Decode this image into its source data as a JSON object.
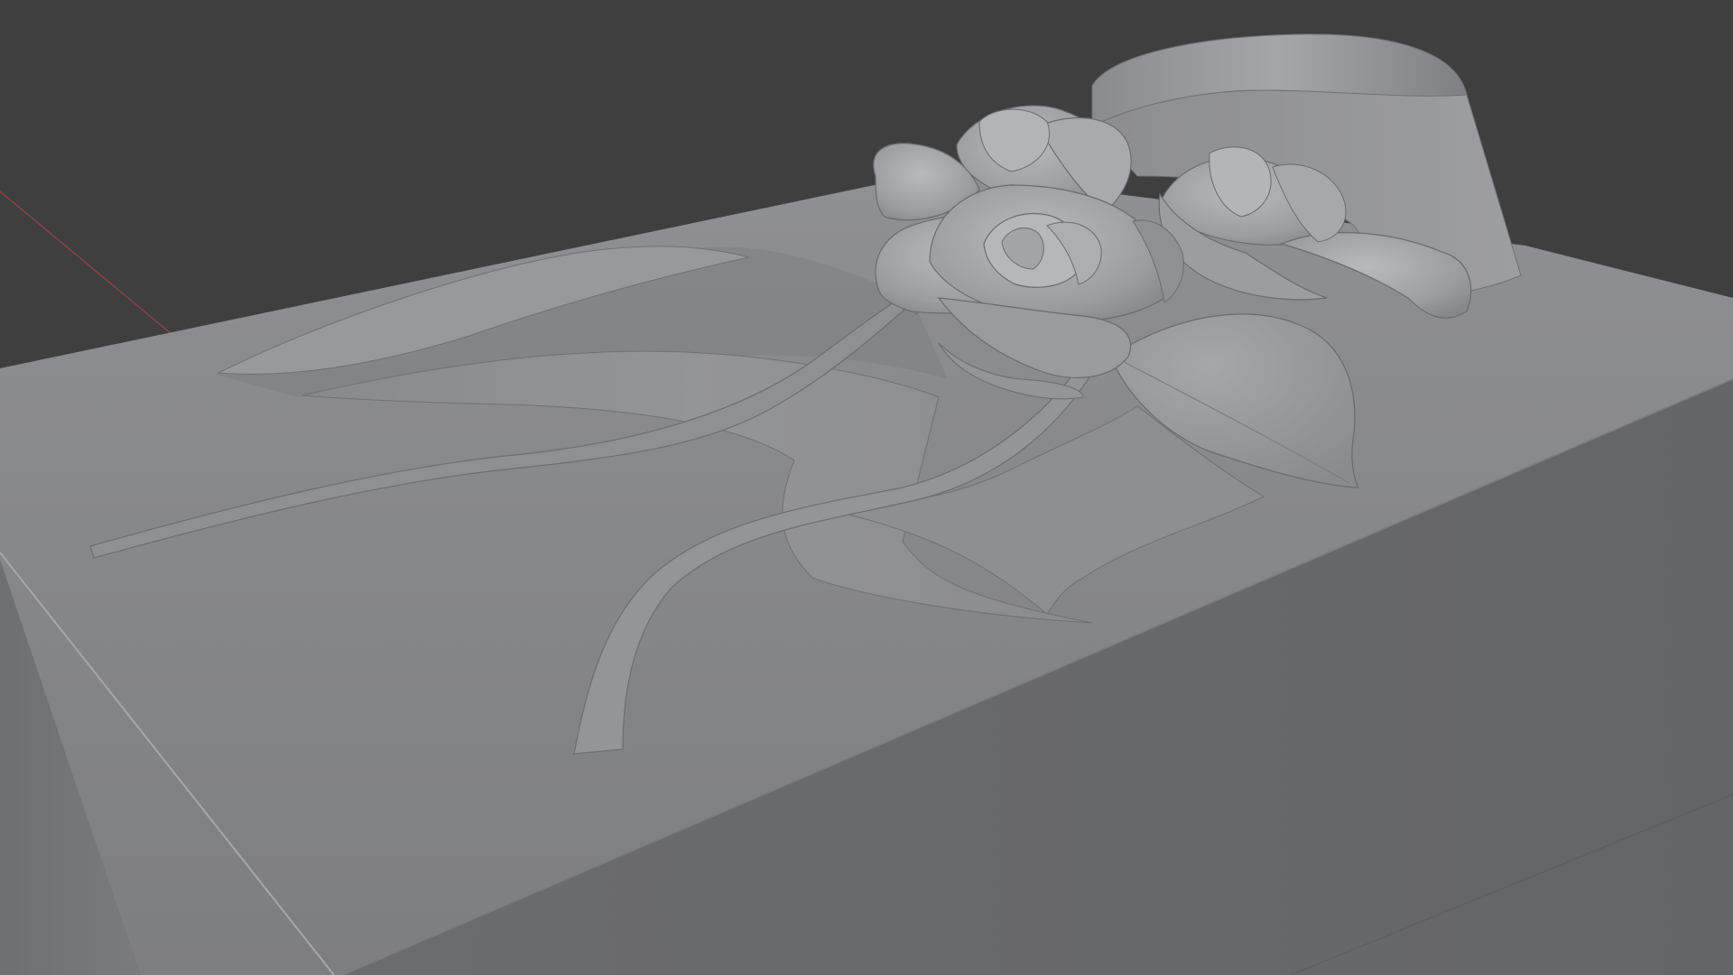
{
  "viewport": {
    "background_color": "#3f3f3f",
    "x_axis_color": "#9a4148",
    "shading": "solid-matcap-gray"
  },
  "scene": {
    "objects": [
      "base-box",
      "ribbon-sash",
      "ribbon-tail-left",
      "ribbon-tail-center",
      "ribbon-tail-lower",
      "rose-large",
      "rose-back",
      "rose-right",
      "leaf-right",
      "cylinder-band"
    ]
  }
}
